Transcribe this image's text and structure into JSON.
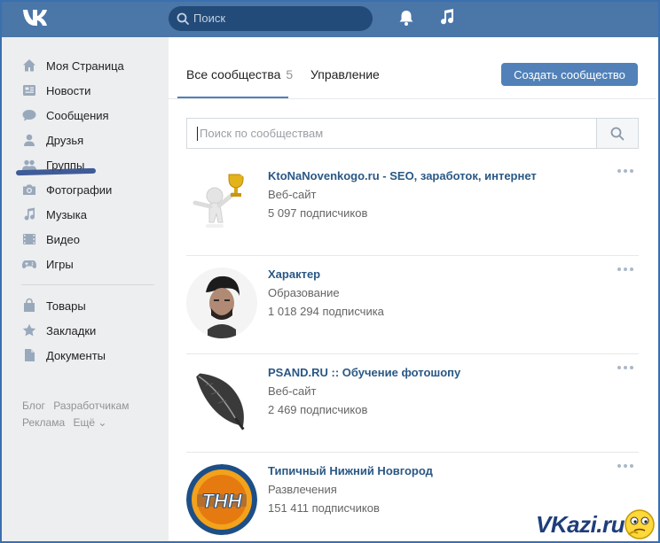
{
  "header": {
    "search_placeholder": "Поиск"
  },
  "sidebar": {
    "items": [
      {
        "label": "Моя Страница",
        "icon": "home-icon"
      },
      {
        "label": "Новости",
        "icon": "news-icon"
      },
      {
        "label": "Сообщения",
        "icon": "messages-icon"
      },
      {
        "label": "Друзья",
        "icon": "friends-icon"
      },
      {
        "label": "Группы",
        "icon": "groups-icon"
      },
      {
        "label": "Фотографии",
        "icon": "camera-icon"
      },
      {
        "label": "Музыка",
        "icon": "music-icon"
      },
      {
        "label": "Видео",
        "icon": "video-icon"
      },
      {
        "label": "Игры",
        "icon": "gamepad-icon"
      }
    ],
    "items2": [
      {
        "label": "Товары",
        "icon": "bag-icon"
      },
      {
        "label": "Закладки",
        "icon": "star-icon"
      },
      {
        "label": "Документы",
        "icon": "document-icon"
      }
    ],
    "footer": {
      "blog": "Блог",
      "developers": "Разработчикам",
      "ads": "Реклама",
      "more": "Ещё ⌄"
    }
  },
  "main": {
    "tabs": [
      {
        "label": "Все сообщества",
        "count": "5"
      },
      {
        "label": "Управление"
      }
    ],
    "create_button": "Создать сообщество",
    "search_placeholder": "Поиск по сообществам",
    "communities": [
      {
        "title": "KtoNaNovenkogo.ru - SEO, заработок, интернет",
        "category": "Веб-сайт",
        "subscribers": "5 097 подписчиков"
      },
      {
        "title": "Характер",
        "category": "Образование",
        "subscribers": "1 018 294 подписчика"
      },
      {
        "title": "PSAND.RU :: Обучение фотошопу",
        "category": "Веб-сайт",
        "subscribers": "2 469 подписчиков"
      },
      {
        "title": "Типичный Нижний Новгород",
        "category": "Развлечения",
        "subscribers": "151 411 подписчиков"
      }
    ]
  },
  "watermark": {
    "text": "VKazi.ru"
  },
  "colors": {
    "header_bg": "#4a76a8",
    "accent": "#5181b8",
    "link": "#2a5885",
    "sidebar_bg": "#edeef0"
  }
}
